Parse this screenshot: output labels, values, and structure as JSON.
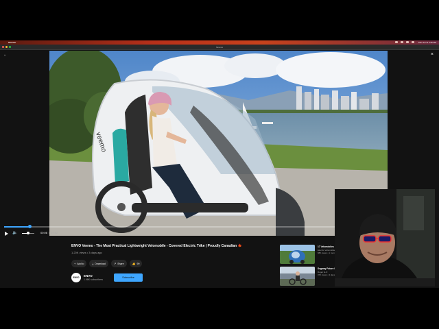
{
  "menubar": {
    "app_name": "Stremio",
    "clock": "Mon Jun 9  4:25 PM"
  },
  "window": {
    "title": "Stremio"
  },
  "overlay": {
    "back_icon": "chevron-down-icon",
    "close_label": "×"
  },
  "player": {
    "progress_fraction": 0.076,
    "volume_fraction": 0.5,
    "current_time": "00:06",
    "separator": "/",
    "duration": "07:52",
    "colors": {
      "progress": "#3ea6ff"
    }
  },
  "video": {
    "title": "ENVO Veemo - The Most Practical Lightweight Velomobile - Covered Electric Trike | Proudly Canadian 🍁",
    "meta": "1.20K views • 3 days ago",
    "actions": [
      {
        "icon": "plus-icon",
        "label": "Add to"
      },
      {
        "icon": "download-icon",
        "label": "Download"
      },
      {
        "icon": "share-icon",
        "label": "Share"
      },
      {
        "icon": "thumbs-up-icon",
        "label": "99"
      }
    ]
  },
  "channel": {
    "avatar_text": "ENVO",
    "name": "ENVO",
    "subscribers": "1.98K subscribers",
    "subscribe_label": "Subscribe"
  },
  "recommendations": [
    {
      "title": "17 Velomobiles",
      "channel": "Electric Velomobile",
      "views": "88K views • 1 month ago"
    },
    {
      "title": "Segway Future Impression",
      "channel": "Roger E-O",
      "views": "37K views • 3 days ago"
    }
  ]
}
